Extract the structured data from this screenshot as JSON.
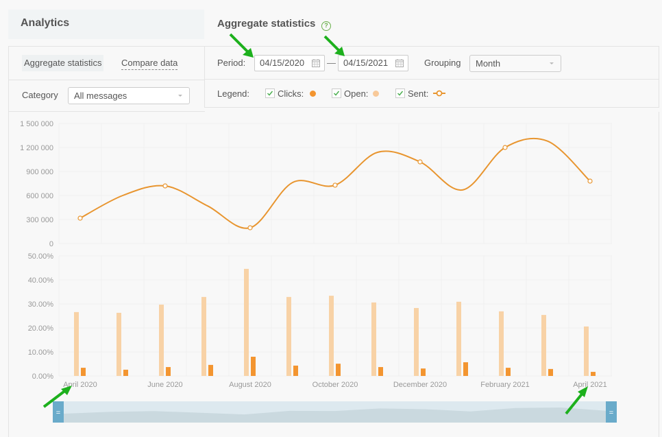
{
  "sidebar": {
    "title": "Analytics"
  },
  "header": {
    "title": "Aggregate statistics",
    "help_icon": "question-circle-icon"
  },
  "tabs": [
    {
      "label": "Aggregate statistics",
      "active": true
    },
    {
      "label": "Compare data",
      "active": false
    }
  ],
  "filters": {
    "category_label": "Category",
    "category_value": "All messages",
    "period_label": "Period:",
    "date_from": "04/15/2020",
    "date_to": "04/15/2021",
    "date_separator": "—",
    "grouping_label": "Grouping",
    "grouping_value": "Month"
  },
  "legend": {
    "label": "Legend:",
    "items": [
      {
        "label": "Clicks:",
        "checked": true,
        "color": "#f39530",
        "marker": "filled-dot"
      },
      {
        "label": "Open:",
        "checked": true,
        "color": "#f8c999",
        "marker": "filled-dot"
      },
      {
        "label": "Sent:",
        "checked": true,
        "color": "#e8952f",
        "marker": "line-with-hollow-dot"
      }
    ]
  },
  "chart_data": [
    {
      "type": "line",
      "title": "Sent",
      "series": [
        {
          "name": "Sent",
          "color": "#e8952f",
          "values": [
            317000,
            600000,
            720000,
            470000,
            197000,
            763000,
            729000,
            1140000,
            1020000,
            670000,
            1200000,
            1280000,
            780000
          ]
        }
      ],
      "x": [
        "April 2020",
        "May 2020",
        "June 2020",
        "July 2020",
        "August 2020",
        "September 2020",
        "October 2020",
        "November 2020",
        "December 2020",
        "January 2021",
        "February 2021",
        "March 2021",
        "April 2021"
      ],
      "markers_on": [
        "April 2020",
        "June 2020",
        "August 2020",
        "October 2020",
        "December 2020",
        "February 2021",
        "April 2021"
      ],
      "ylim": [
        0,
        1500000
      ],
      "yticks": [
        "0",
        "300 000",
        "600 000",
        "900 000",
        "1 200 000",
        "1 500 000"
      ],
      "grid": true
    },
    {
      "type": "bar",
      "categories": [
        "April 2020",
        "May 2020",
        "June 2020",
        "July 2020",
        "August 2020",
        "September 2020",
        "October 2020",
        "November 2020",
        "December 2020",
        "January 2021",
        "February 2021",
        "March 2021",
        "April 2021"
      ],
      "series": [
        {
          "name": "Open",
          "color": "#f8d2a6",
          "values": [
            26.6,
            26.3,
            29.7,
            32.9,
            44.6,
            32.9,
            33.4,
            30.6,
            28.3,
            30.9,
            26.9,
            25.4,
            20.6
          ]
        },
        {
          "name": "Clicks",
          "color": "#f39530",
          "values": [
            3.4,
            2.6,
            3.7,
            4.6,
            8.0,
            4.3,
            5.1,
            3.7,
            3.1,
            5.7,
            3.4,
            2.9,
            1.7
          ]
        }
      ],
      "ylim": [
        0,
        50
      ],
      "yticks": [
        "0.00%",
        "10.00%",
        "20.00%",
        "30.00%",
        "40.00%",
        "50.00%"
      ],
      "xtick_labels": [
        "April 2020",
        "June 2020",
        "August 2020",
        "October 2020",
        "December 2020",
        "February 2021",
        "April 2021"
      ],
      "grid": true
    }
  ],
  "navigator": {
    "range_start": "April 2020",
    "range_end": "April 2021",
    "handle_glyph": "="
  }
}
